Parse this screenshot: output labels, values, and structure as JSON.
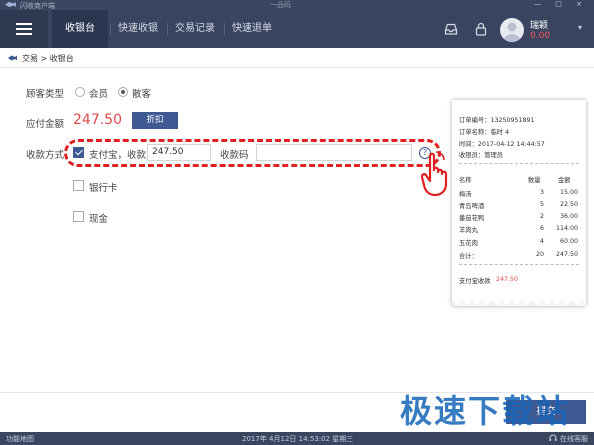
{
  "window": {
    "app_name": "闪收商户端",
    "brand": "一品码",
    "controls": "— □ ×"
  },
  "nav": {
    "tabs": [
      {
        "label": "收银台",
        "active": true
      },
      {
        "label": "快速收银",
        "active": false
      },
      {
        "label": "交易记录",
        "active": false
      },
      {
        "label": "快速退单",
        "active": false
      }
    ],
    "icons": [
      "inbox-icon",
      "lock-icon",
      "avatar-icon"
    ],
    "user": {
      "name": "瑞颖",
      "balance": "0.00"
    }
  },
  "breadcrumb": {
    "text": "交易 > 收银台"
  },
  "form": {
    "customer_type_label": "顾客类型",
    "customer_types": [
      {
        "label": "会员",
        "checked": false
      },
      {
        "label": "散客",
        "checked": true
      }
    ],
    "amount_due_label": "应付金额",
    "amount_due": "247.50",
    "discount_button": "折扣",
    "payment_method_label": "收款方式",
    "alipay": {
      "label": "支付宝，收款",
      "checked": true,
      "amount": "247.50",
      "code_label": "收款码",
      "code_value": "",
      "help": "?"
    },
    "bank_card": {
      "label": "银行卡",
      "checked": false
    },
    "cash": {
      "label": "现金",
      "checked": false
    }
  },
  "receipt": {
    "order_no": "订单编号：13250951891",
    "order_name": "订单名称：临时 4",
    "time": "时间：2017-04-12 14:44:57",
    "cashier": "收银员：管理员",
    "headers": {
      "name": "名称",
      "qty": "数量",
      "amount": "金额"
    },
    "items": [
      {
        "name": "梅汤",
        "qty": "3",
        "amount": "15.00"
      },
      {
        "name": "青岛啤酒",
        "qty": "5",
        "amount": "22.50"
      },
      {
        "name": "番茄花鸭",
        "qty": "2",
        "amount": "36.00"
      },
      {
        "name": "羊肉丸",
        "qty": "6",
        "amount": "114.00"
      },
      {
        "name": "五花肉",
        "qty": "4",
        "amount": "60.00"
      }
    ],
    "total": {
      "name": "合计：",
      "qty": "20",
      "amount": "247.50"
    },
    "payment_label": "支付宝收款",
    "payment_amount": "247.50"
  },
  "footer": {
    "confirm_button": "提交",
    "watermark": "极速下载站"
  },
  "statusbar": {
    "left": "功能地图",
    "datetime": "2017年 4月12日 14:53:02 星期三",
    "right": "在线客服"
  },
  "colors": {
    "nav_bg": "#384460",
    "accent": "#3f5a92",
    "amount_red": "#e0494a",
    "highlight_red": "#e02020"
  }
}
